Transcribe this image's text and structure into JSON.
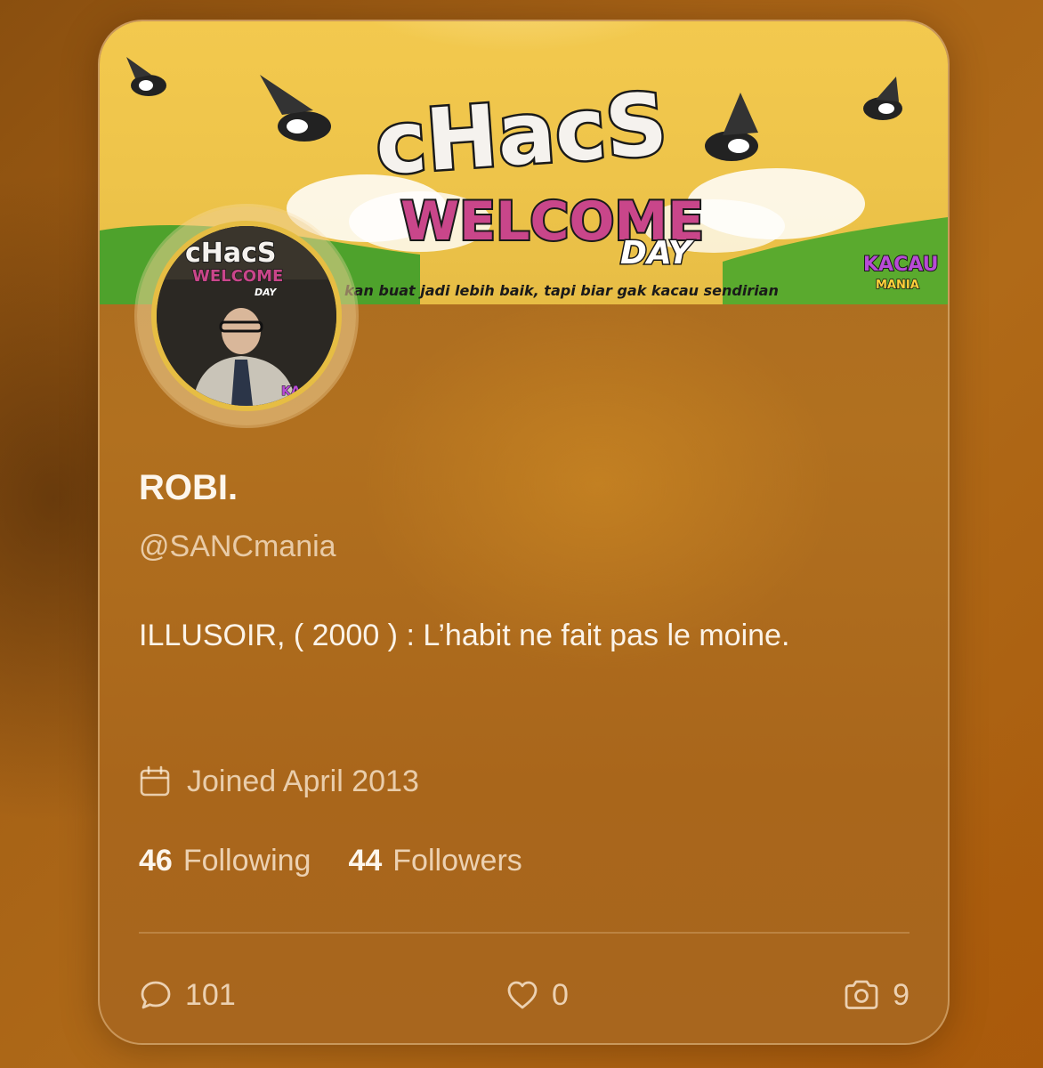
{
  "profile": {
    "display_name": "ROBI.",
    "handle": "@SANCmania",
    "bio": "ILLUSOIR, ( 2000 ) : L’habit ne fait pas le moine.",
    "joined": "Joined April 2013"
  },
  "banner": {
    "title_line1": "cHacS",
    "title_line2": "WELCOME",
    "title_line3": "DAY",
    "tagline": "kan buat jadi lebih baik, tapi biar gak kacau sendirian",
    "badge_line1": "KACAU",
    "badge_line2": "MANIA"
  },
  "avatar": {
    "title_line1": "cHacS",
    "title_line2": "WELCOME",
    "title_line3": "DAY",
    "badge": "KACAU"
  },
  "stats": {
    "following_count": "46",
    "following_label": "Following",
    "followers_count": "44",
    "followers_label": "Followers"
  },
  "actions": {
    "replies": "101",
    "likes": "0",
    "media": "9"
  },
  "icons": {
    "calendar": "calendar-icon",
    "reply": "speech-bubble-icon",
    "like": "heart-icon",
    "media": "camera-icon"
  },
  "colors": {
    "banner_yellow": "#f3c94e",
    "banner_green": "#4ea22c",
    "card_bg": "#a86b22",
    "text_primary": "#fdf6ec"
  }
}
